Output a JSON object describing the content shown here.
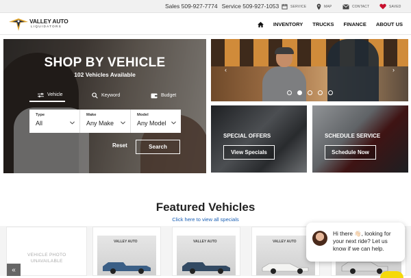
{
  "topbar": {
    "sales": "Sales 509-927-7774",
    "service_phone": "Service 509-927-1053",
    "links": [
      {
        "label": "SERVICE",
        "icon": "calendar-icon"
      },
      {
        "label": "MAP",
        "icon": "map-pin-icon"
      },
      {
        "label": "CONTACT",
        "icon": "envelope-icon"
      },
      {
        "label": "SAVED",
        "icon": "heart-icon"
      }
    ]
  },
  "header": {
    "logo_line1": "VALLEY AUTO",
    "logo_line2": "LIQUIDATORS",
    "nav": [
      "INVENTORY",
      "TRUCKS",
      "FINANCE",
      "ABOUT US"
    ]
  },
  "hero": {
    "title": "SHOP BY VEHICLE",
    "subtitle": "102 Vehicles Available",
    "tabs": [
      "Vehicle",
      "Keyword",
      "Budget"
    ],
    "selects": [
      {
        "label": "Type",
        "value": "All"
      },
      {
        "label": "Make",
        "value": "Any Make"
      },
      {
        "label": "Model",
        "value": "Any Model"
      }
    ],
    "reset_label": "Reset",
    "search_label": "Search"
  },
  "slider": {
    "slides": 5,
    "active": 1
  },
  "tiles": [
    {
      "title": "SPECIAL OFFERS",
      "button": "View Specials"
    },
    {
      "title": "SCHEDULE SERVICE",
      "button": "Schedule Now"
    }
  ],
  "featured": {
    "title": "Featured Vehicles",
    "link": "Click here to view all specials",
    "unavailable_text": [
      "VEHICLE PHOTO",
      "UNAVAILABLE"
    ],
    "card_logo": "VALLEY AUTO"
  },
  "chat": {
    "message": "Hi there 👋🏻, looking for your next ride? Let us know if we can help."
  },
  "colors": {
    "accent": "#c8102e",
    "link": "#1a5fb4",
    "chat_button": "#f5d90a"
  }
}
